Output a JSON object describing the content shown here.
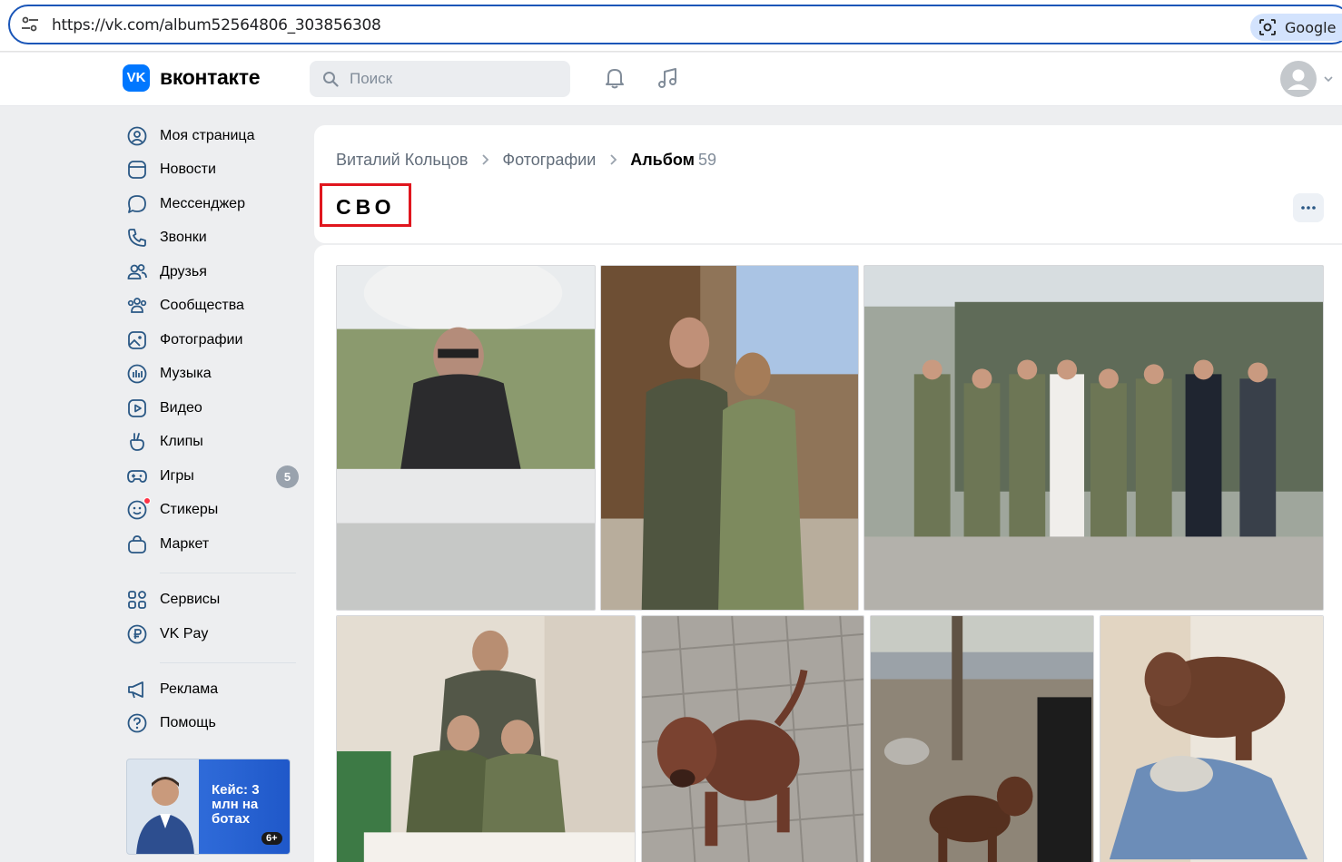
{
  "browser": {
    "url": "https://vk.com/album52564806_303856308",
    "lens_label": "Google Lens"
  },
  "header": {
    "logo_text": "VK",
    "brand": "вконтакте",
    "search_placeholder": "Поиск",
    "icons": [
      "bell-icon",
      "music-note-icon"
    ]
  },
  "sidebar": {
    "items": [
      {
        "label": "Моя страница",
        "icon": "user-circle-icon"
      },
      {
        "label": "Новости",
        "icon": "news-icon"
      },
      {
        "label": "Мессенджер",
        "icon": "message-bubble-icon"
      },
      {
        "label": "Звонки",
        "icon": "phone-icon"
      },
      {
        "label": "Друзья",
        "icon": "friends-icon"
      },
      {
        "label": "Сообщества",
        "icon": "communities-icon"
      },
      {
        "label": "Фотографии",
        "icon": "photo-icon"
      },
      {
        "label": "Музыка",
        "icon": "music-bars-icon"
      },
      {
        "label": "Видео",
        "icon": "video-icon"
      },
      {
        "label": "Клипы",
        "icon": "clips-icon"
      },
      {
        "label": "Игры",
        "icon": "gamepad-icon",
        "badge": "5"
      },
      {
        "label": "Стикеры",
        "icon": "sticker-icon"
      },
      {
        "label": "Маркет",
        "icon": "market-bag-icon"
      }
    ],
    "items2": [
      {
        "label": "Сервисы",
        "icon": "services-grid-icon"
      },
      {
        "label": "VK Pay",
        "icon": "ruble-coin-icon"
      }
    ],
    "items3": [
      {
        "label": "Реклама",
        "icon": "megaphone-icon"
      },
      {
        "label": "Помощь",
        "icon": "help-icon"
      }
    ],
    "promo": {
      "text": "Кейс: 3 млн на ботах",
      "age": "6+"
    }
  },
  "breadcrumb": {
    "owner": "Виталий Кольцов",
    "section": "Фотографии",
    "current": "Альбом",
    "count": "59"
  },
  "album": {
    "title": "СВО"
  },
  "colors": {
    "accent": "#0077ff",
    "highlight_border": "#e0161e",
    "badge": "#99a2ad",
    "page_bg": "#edeef0"
  }
}
